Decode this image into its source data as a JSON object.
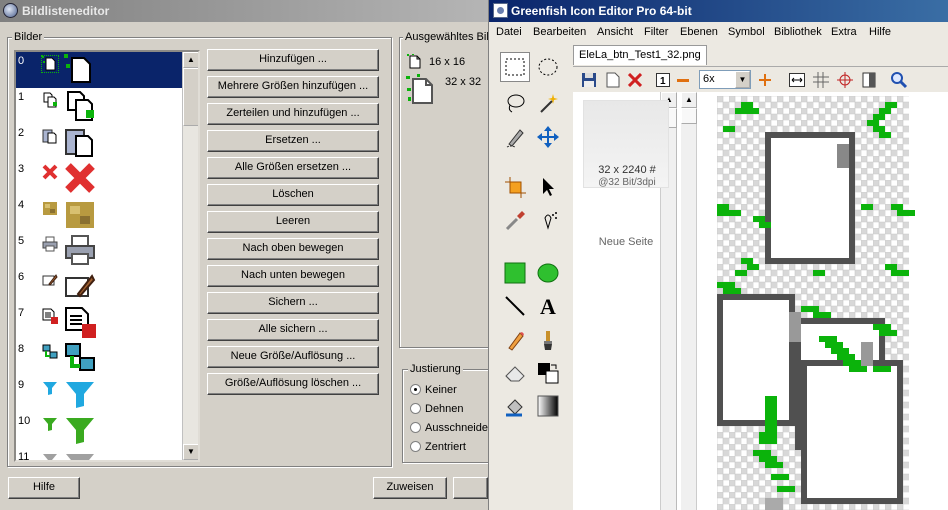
{
  "left_window": {
    "title": "Bildlisteneditor",
    "group_images": "Bilder",
    "items": [
      {
        "index": "0",
        "icon": "new-document-icon",
        "selected": true
      },
      {
        "index": "1",
        "icon": "copy-document-icon"
      },
      {
        "index": "2",
        "icon": "paste-document-icon"
      },
      {
        "index": "3",
        "icon": "red-x-delete-icon"
      },
      {
        "index": "4",
        "icon": "gold-texture-icon"
      },
      {
        "index": "5",
        "icon": "printer-icon"
      },
      {
        "index": "6",
        "icon": "edit-pencil-icon"
      },
      {
        "index": "7",
        "icon": "save-document-icon"
      },
      {
        "index": "8",
        "icon": "network-computers-icon"
      },
      {
        "index": "9",
        "icon": "cyan-filter-icon"
      },
      {
        "index": "10",
        "icon": "green-filter-icon"
      },
      {
        "index": "11",
        "icon": "gray-filter-icon"
      }
    ],
    "buttons": [
      "Hinzufügen ...",
      "Mehrere Größen hinzufügen ...",
      "Zerteilen und hinzufügen ...",
      "Ersetzen ...",
      "Alle Größen ersetzen ...",
      "Löschen",
      "Leeren",
      "Nach oben bewegen",
      "Nach unten bewegen",
      "Sichern ...",
      "Alle sichern ...",
      "Neue Größe/Auflösung ...",
      "Größe/Auflösung löschen ..."
    ],
    "group_selected": "Ausgewähltes Bild",
    "sizes": [
      "16 x 16",
      "32 x 32"
    ],
    "group_justify": "Justierung",
    "justify_options": [
      "Keiner",
      "Dehnen",
      "Ausschneiden",
      "Zentriert"
    ],
    "justify_selected": "Keiner",
    "help_button": "Hilfe",
    "assign_button": "Zuweisen"
  },
  "right_window": {
    "title": "Greenfish Icon Editor Pro 64-bit",
    "menu": [
      "Datei",
      "Bearbeiten",
      "Ansicht",
      "Filter",
      "Ebenen",
      "Symbol",
      "Bibliothek",
      "Extra",
      "Hilfe"
    ],
    "tab_label": "EleLa_btn_Test1_32.png",
    "zoom_value": "6x",
    "page_size": "32 x 2240 #",
    "page_format": "@32 Bit/3dpi",
    "new_page": "Neue Seite",
    "tools": [
      "rect-select-icon",
      "ellipse-select-icon",
      "lasso-icon",
      "magic-wand-icon",
      "pen-select-icon",
      "move-icon",
      "crop-icon",
      "pointer-icon",
      "color-picker-icon",
      "spray-icon",
      "rectangle-icon",
      "ellipse-icon",
      "line-icon",
      "text-icon",
      "pencil-icon",
      "brush-icon",
      "eraser-icon",
      "color-replace-icon",
      "fill-icon",
      "gradient-icon"
    ],
    "colors": {
      "accent_green": "#0bb30b",
      "dark_gray": "#505050",
      "selection_blue": "#0a246a"
    }
  }
}
